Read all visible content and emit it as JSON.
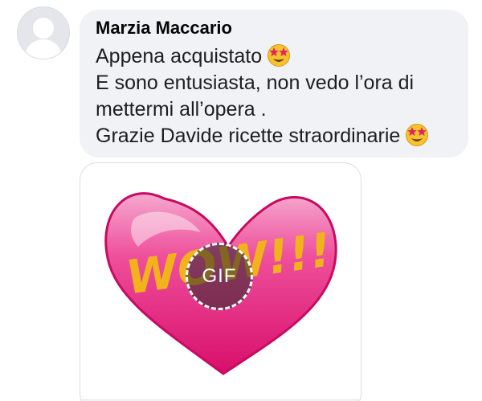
{
  "comment": {
    "author": "Marzia Maccario",
    "lines": [
      "Appena acquistato",
      "E sono entusiasta, non vedo l’ora di",
      "mettermi all’opera .",
      "Grazie Davide ricette straordinarie"
    ],
    "emoji": "star-struck-emoji"
  },
  "gif": {
    "badge_label": "GIF",
    "artwork_text": "WOW!!!"
  },
  "colors": {
    "bubble_bg": "#f0f2f5",
    "heart_pink": "#e8197a",
    "wow_yellow": "#f2b21c"
  }
}
